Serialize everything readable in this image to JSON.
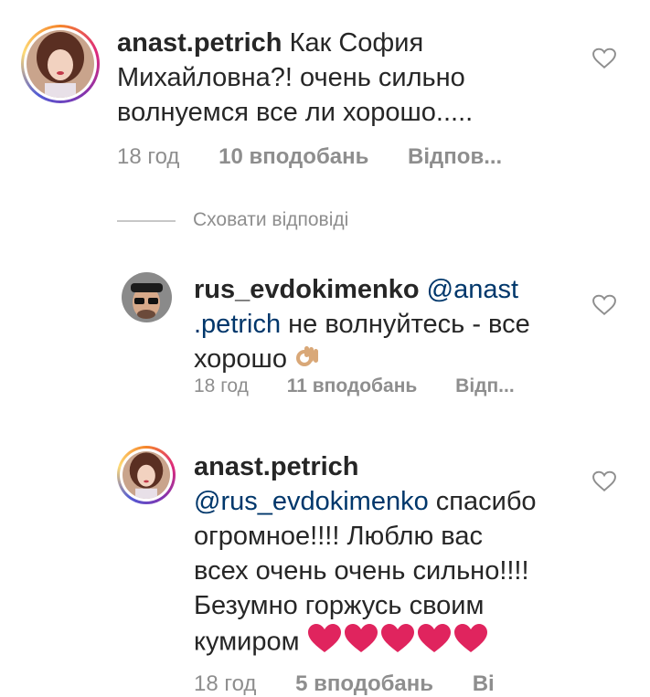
{
  "comments": [
    {
      "username": "anast.petrich",
      "text": "Как София Михайловна?! очень сильно волнуемся все ли хорошо.....",
      "time": "18 год",
      "likes": "10 вподобань",
      "reply": "Відпов..."
    }
  ],
  "hide_replies": "Сховати відповіді",
  "replies": [
    {
      "username": "rus_evdokimenko",
      "mention_part1": "@anast",
      "mention_part2": ".petrich",
      "text_part1": " не волнуйтесь - все",
      "text_part2": "хорошо",
      "time": "18 год",
      "likes": "11 вподобань",
      "reply": "Відп..."
    },
    {
      "username": "anast.petrich",
      "mention": "@rus_evdokimenko",
      "text_line1": " спасибо",
      "text_line2": "огромное!!!! Люблю вас",
      "text_line3": "всех очень очень сильно!!!!",
      "text_line4": "Безумно горжусь своим",
      "text_line5": "кумиром",
      "time": "18 год",
      "likes": "5 вподобань",
      "reply": "Ві"
    }
  ],
  "colors": {
    "heart_emoji": "#e0245e",
    "meta_gray": "#8e8e8e",
    "mention_blue": "#00376b"
  }
}
